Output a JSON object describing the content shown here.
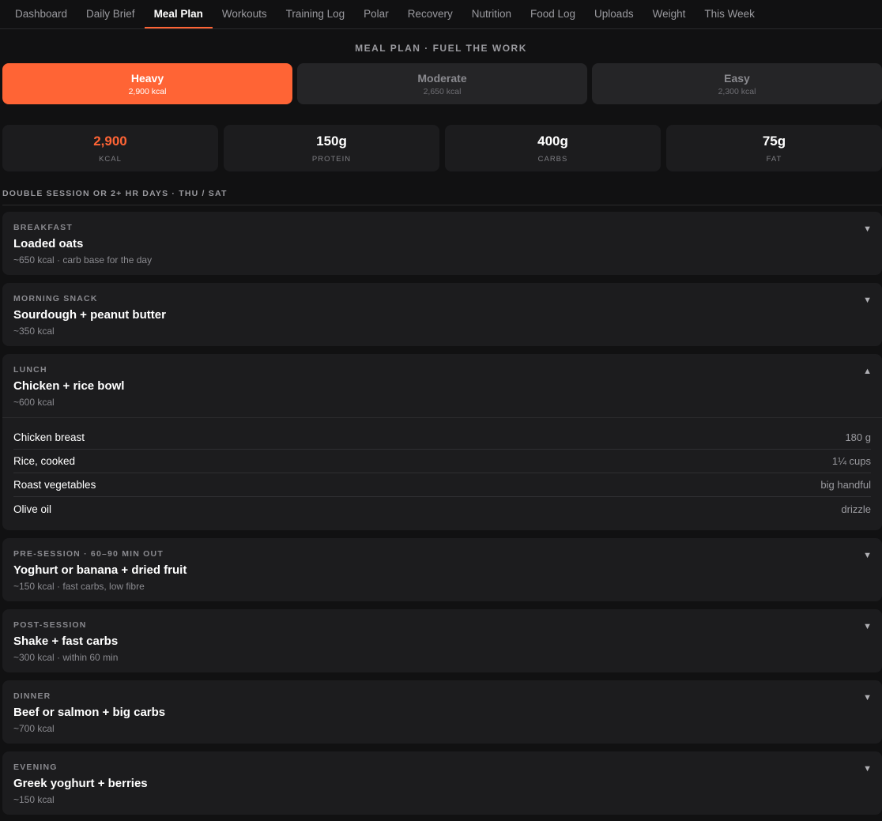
{
  "nav": {
    "tabs": [
      {
        "label": "Dashboard",
        "active": false
      },
      {
        "label": "Daily Brief",
        "active": false
      },
      {
        "label": "Meal Plan",
        "active": true
      },
      {
        "label": "Workouts",
        "active": false
      },
      {
        "label": "Training Log",
        "active": false
      },
      {
        "label": "Polar",
        "active": false
      },
      {
        "label": "Recovery",
        "active": false
      },
      {
        "label": "Nutrition",
        "active": false
      },
      {
        "label": "Food Log",
        "active": false
      },
      {
        "label": "Uploads",
        "active": false
      },
      {
        "label": "Weight",
        "active": false
      },
      {
        "label": "This Week",
        "active": false
      }
    ]
  },
  "page": {
    "title": "MEAL PLAN · FUEL THE WORK"
  },
  "levels": [
    {
      "name": "Heavy",
      "kcal": "2,900 kcal",
      "active": true
    },
    {
      "name": "Moderate",
      "kcal": "2,650 kcal",
      "active": false
    },
    {
      "name": "Easy",
      "kcal": "2,300 kcal",
      "active": false
    }
  ],
  "macros": [
    {
      "value": "2,900",
      "label": "KCAL"
    },
    {
      "value": "150g",
      "label": "PROTEIN"
    },
    {
      "value": "400g",
      "label": "CARBS"
    },
    {
      "value": "75g",
      "label": "FAT"
    }
  ],
  "colors": {
    "accent": "#ff6435",
    "background": "#111112",
    "card": "#1c1c1e"
  },
  "section": {
    "label": "DOUBLE SESSION OR 2+ HR DAYS · THU / SAT"
  },
  "meals": [
    {
      "category": "BREAKFAST",
      "name": "Loaded oats",
      "sub": "~650 kcal · carb base for the day",
      "chevron": "▼",
      "expanded": false
    },
    {
      "category": "MORNING SNACK",
      "name": "Sourdough + peanut butter",
      "sub": "~350 kcal",
      "chevron": "▼",
      "expanded": false
    },
    {
      "category": "LUNCH",
      "name": "Chicken + rice bowl",
      "sub": "~600 kcal",
      "chevron": "▲",
      "expanded": true,
      "items": [
        {
          "name": "Chicken breast",
          "qty": "180 g"
        },
        {
          "name": "Rice, cooked",
          "qty": "1¼ cups"
        },
        {
          "name": "Roast vegetables",
          "qty": "big handful"
        },
        {
          "name": "Olive oil",
          "qty": "drizzle"
        }
      ]
    },
    {
      "category": "PRE-SESSION · 60–90 MIN OUT",
      "name": "Yoghurt or banana + dried fruit",
      "sub": "~150 kcal · fast carbs, low fibre",
      "chevron": "▼",
      "expanded": false
    },
    {
      "category": "POST-SESSION",
      "name": "Shake + fast carbs",
      "sub": "~300 kcal · within 60 min",
      "chevron": "▼",
      "expanded": false
    },
    {
      "category": "DINNER",
      "name": "Beef or salmon + big carbs",
      "sub": "~700 kcal",
      "chevron": "▼",
      "expanded": false
    },
    {
      "category": "EVENING",
      "name": "Greek yoghurt + berries",
      "sub": "~150 kcal",
      "chevron": "▼",
      "expanded": false
    }
  ]
}
